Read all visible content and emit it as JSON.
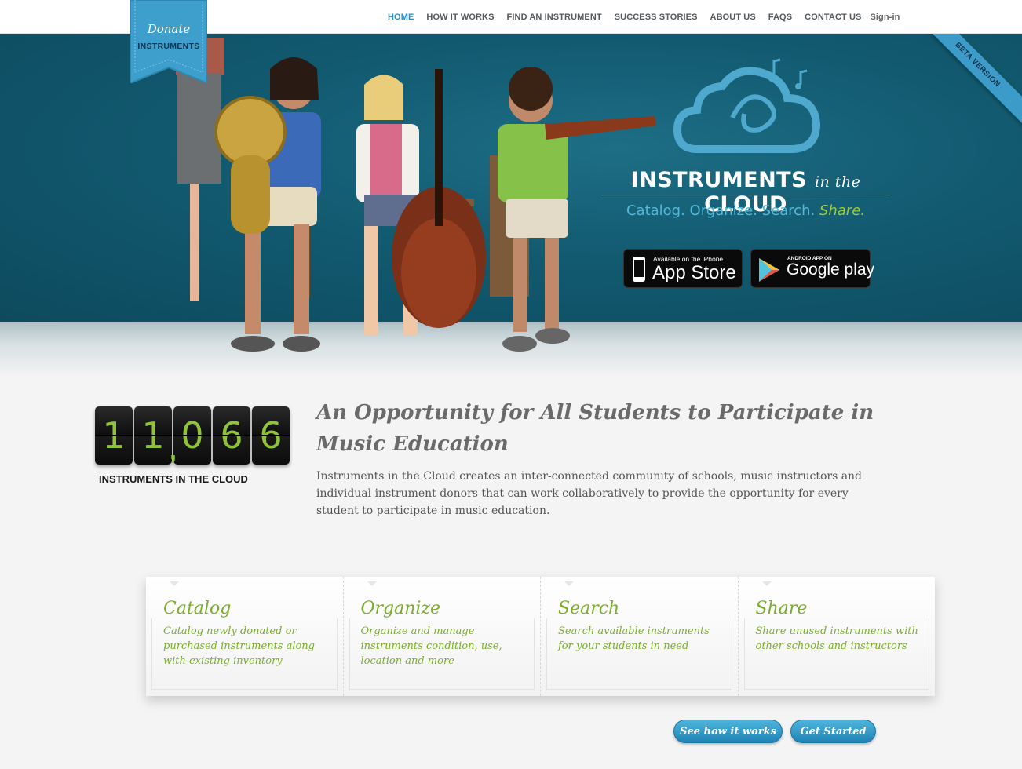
{
  "nav": {
    "items": [
      {
        "label": "HOME",
        "active": true
      },
      {
        "label": "HOW IT WORKS"
      },
      {
        "label": "FIND AN INSTRUMENT"
      },
      {
        "label": "SUCCESS STORIES"
      },
      {
        "label": "ABOUT US"
      },
      {
        "label": "FAQS"
      },
      {
        "label": "CONTACT US"
      }
    ],
    "signin": "Sign-in"
  },
  "donate": {
    "line1": "Donate",
    "line2": "INSTRUMENTS"
  },
  "hero": {
    "beta": "BETA VERSION",
    "brand_a": "INSTRUMENTS",
    "brand_b": "in the",
    "brand_c": "CLOUD",
    "tagline_main": "Catalog. Organize. Search.",
    "tagline_share": "Share.",
    "appstore_small": "Available on the iPhone",
    "appstore_big": "App Store",
    "gplay_small": "ANDROID APP ON",
    "gplay_big": "Google play"
  },
  "counter": {
    "digits": [
      "1",
      "1",
      "0",
      "6",
      "6"
    ],
    "comma": ",",
    "label": "INSTRUMENTS IN THE CLOUD"
  },
  "intro": {
    "headline": "An Opportunity for All Students to Participate in Music Education",
    "body": "Instruments in the Cloud creates an inter-connected community of schools, music instructors and individual instrument donors that can work collaboratively to provide the opportunity for every student to participate in music education."
  },
  "features": [
    {
      "title": "Catalog",
      "text": "Catalog newly donated or purchased instruments along with existing inventory"
    },
    {
      "title": "Organize",
      "text": "Organize and manage instruments condition, use, location and more"
    },
    {
      "title": "Search",
      "text": "Search available instruments for your students in need"
    },
    {
      "title": "Share",
      "text": "Share unused instruments with other schools and instructors"
    }
  ],
  "buttons": {
    "how": "See how it works",
    "start": "Get Started"
  },
  "colors": {
    "accent_blue": "#2a8fce",
    "hero_teal": "#125a70",
    "green": "#7aae2a"
  }
}
